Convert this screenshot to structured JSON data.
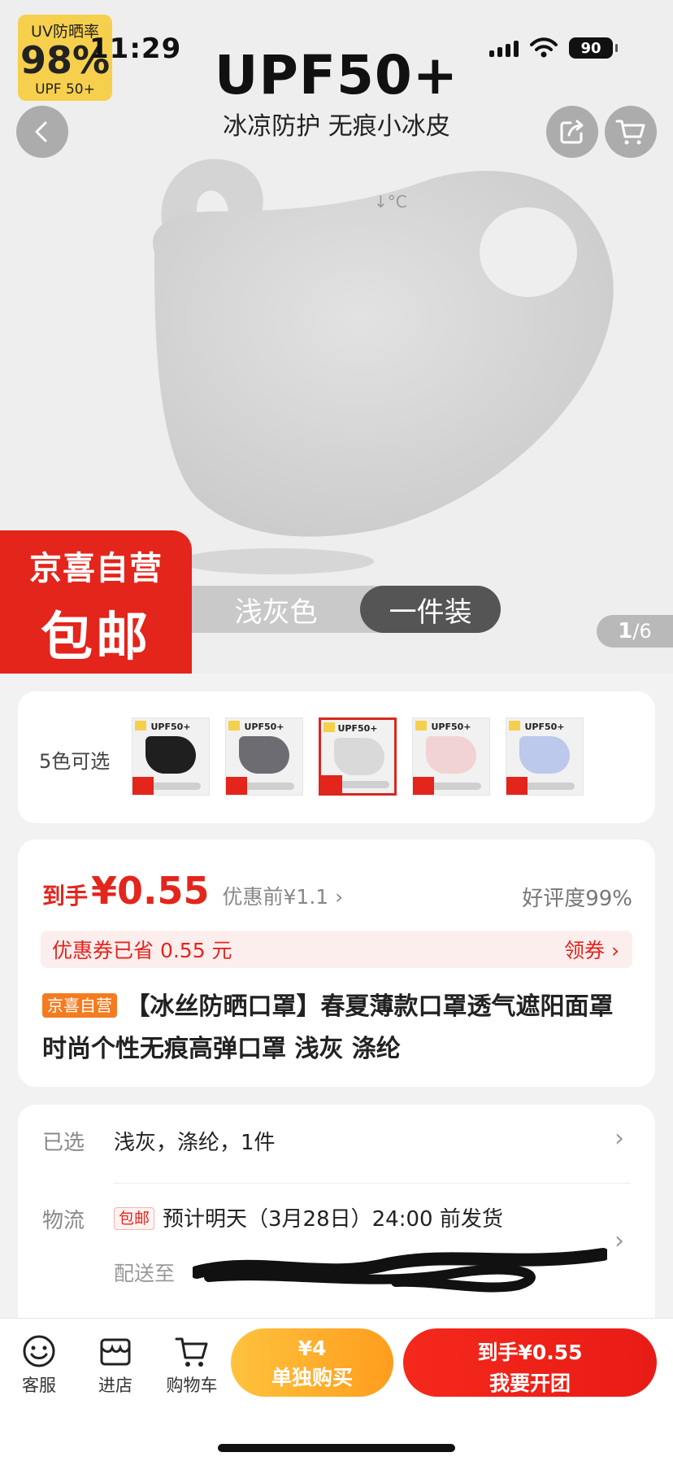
{
  "status": {
    "time": "11:29",
    "battery": "90"
  },
  "hero": {
    "uv_badge": {
      "line1": "UV防晒率",
      "line2": "98%",
      "line3": "UPF 50+"
    },
    "title": "UPF50+",
    "subtitle": "冰凉防护 无痕小冰皮",
    "mask_label": "↓°C",
    "promo": {
      "line1": "京喜自营",
      "line2": "包邮"
    },
    "variant": {
      "color": "浅灰色",
      "pack": "一件装"
    },
    "page_indicator": {
      "current": "1",
      "total": "/6"
    }
  },
  "colors": {
    "label": "5色可选",
    "thumbs": [
      {
        "title": "UPF50+",
        "swatch": "#1f1f1f",
        "selected": false
      },
      {
        "title": "UPF50+",
        "swatch": "#6c6c72",
        "selected": false
      },
      {
        "title": "UPF50+",
        "swatch": "#d9d9d9",
        "selected": true
      },
      {
        "title": "UPF50+",
        "swatch": "#f1d3d3",
        "selected": false
      },
      {
        "title": "UPF50+",
        "swatch": "#bcc8ec",
        "selected": false
      }
    ]
  },
  "price": {
    "prefix": "到手",
    "amount": "¥0.55",
    "before": "优惠前¥1.1 ›",
    "rating": "好评度99%",
    "coupon_text": "优惠券已省 0.55 元",
    "coupon_action": "领券 ›",
    "tag": "京喜自营",
    "title": "【冰丝防晒口罩】春夏薄款口罩透气遮阳面罩时尚个性无痕高弹口罩 浅灰 涤纶"
  },
  "selection": {
    "selected_label": "已选",
    "selected_value": "浅灰，涤纶，1件",
    "logistics_label": "物流",
    "shipping_tag": "包邮",
    "shipping_text": "预计明天（3月28日）24:00 前发货",
    "address_prefix": "配送至"
  },
  "bottom": {
    "service": "客服",
    "store": "进店",
    "cart": "购物车",
    "single_price": "¥4",
    "single_label": "单独购买",
    "group_price": "到手¥0.55",
    "group_label": "我要开团"
  },
  "colors_theme": {
    "accent": "#e3251c",
    "orange": "#ff9d1e",
    "badge_yellow": "#f6d04d"
  }
}
